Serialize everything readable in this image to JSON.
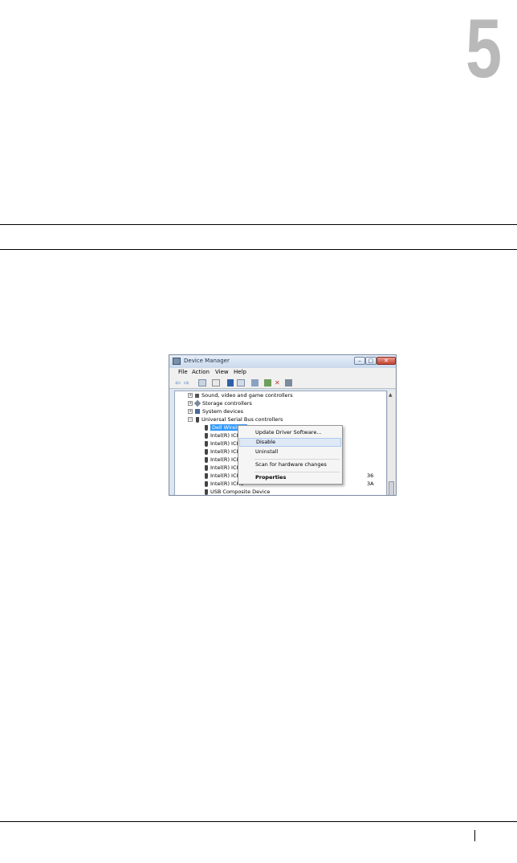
{
  "chapter": {
    "number": "5"
  },
  "window": {
    "title": "Device Manager",
    "controls": {
      "minimize": "–",
      "maximize": "□",
      "close": "✕"
    },
    "menu": [
      "File",
      "Action",
      "View",
      "Help"
    ],
    "toolbar_icons": [
      "back-icon",
      "forward-icon",
      "properties-icon",
      "show-hidden-icon",
      "help-icon",
      "device-view-icon",
      "scan-icon",
      "update-driver-icon",
      "uninstall-icon",
      "disable-icon"
    ],
    "tree": {
      "rows": [
        {
          "label": "Sound, video and game controllers",
          "expander": "+"
        },
        {
          "label": "Storage controllers",
          "expander": "+"
        },
        {
          "label": "System devices",
          "expander": "+"
        },
        {
          "label": "Universal Serial Bus controllers",
          "expander": "−"
        }
      ],
      "children": [
        "Dell Wireless",
        "Intel(R) ICH8",
        "Intel(R) ICH8",
        "Intel(R) ICH8",
        "Intel(R) ICH8",
        "Intel(R) ICH8",
        "Intel(R) ICH8",
        "Intel(R) ICH8",
        "USB Composite Device"
      ],
      "trailing": [
        "36",
        "3A"
      ]
    },
    "context_menu": {
      "items": [
        "Update Driver Software...",
        "Disable",
        "Uninstall",
        "Scan for hardware changes",
        "Properties"
      ]
    }
  }
}
